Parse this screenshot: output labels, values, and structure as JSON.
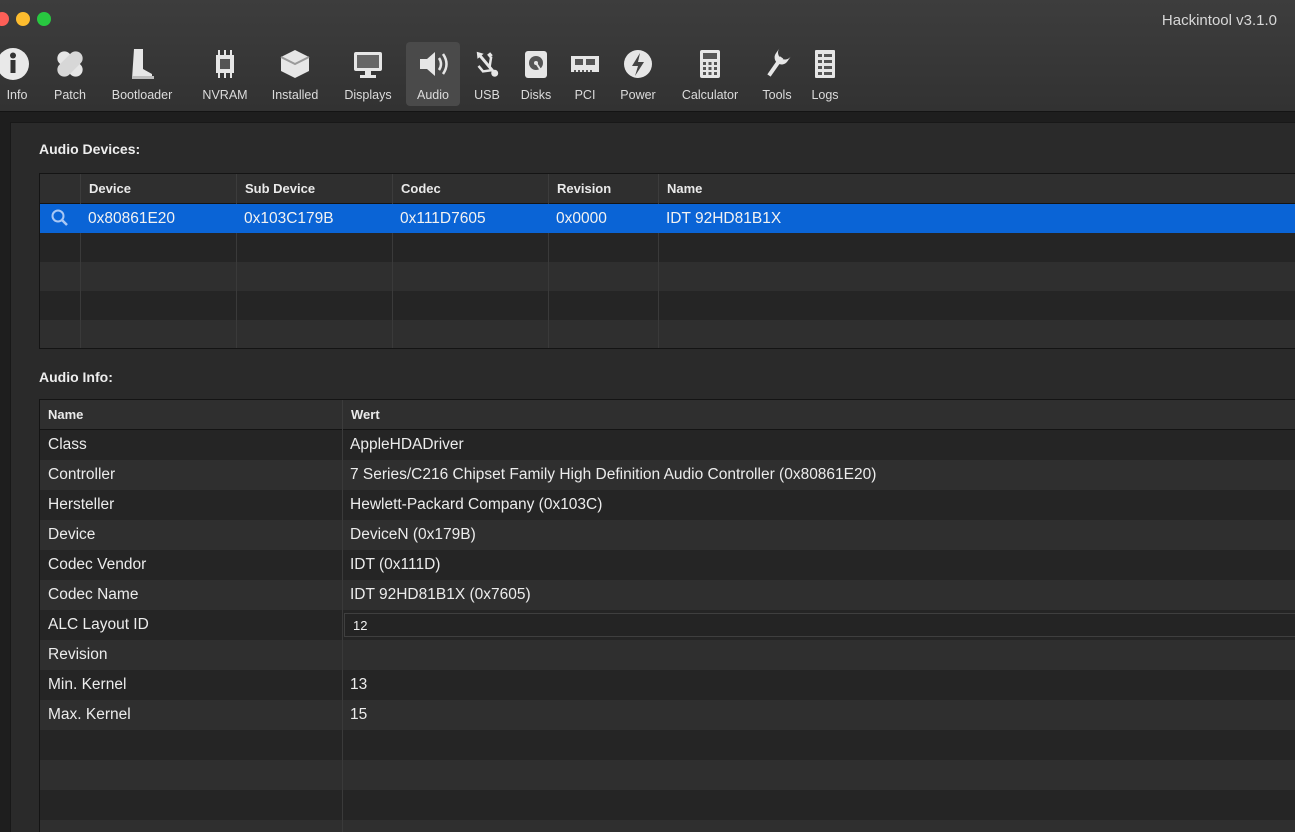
{
  "window": {
    "title": "Hackintool v3.1.0"
  },
  "toolbar": {
    "items": [
      {
        "label": "Info",
        "icon": "info-icon"
      },
      {
        "label": "Patch",
        "icon": "bandage-icon"
      },
      {
        "label": "Bootloader",
        "icon": "boot-icon"
      },
      {
        "label": "NVRAM",
        "icon": "chip-icon"
      },
      {
        "label": "Installed",
        "icon": "package-icon"
      },
      {
        "label": "Displays",
        "icon": "monitor-icon"
      },
      {
        "label": "Audio",
        "icon": "speaker-icon",
        "active": true
      },
      {
        "label": "USB",
        "icon": "usb-icon"
      },
      {
        "label": "Disks",
        "icon": "disk-icon"
      },
      {
        "label": "PCI",
        "icon": "pci-card-icon"
      },
      {
        "label": "Power",
        "icon": "power-icon"
      },
      {
        "label": "Calculator",
        "icon": "calculator-icon"
      },
      {
        "label": "Tools",
        "icon": "wrench-icon"
      },
      {
        "label": "Logs",
        "icon": "log-list-icon"
      }
    ]
  },
  "audio_devices": {
    "title": "Audio Devices:",
    "columns": [
      "Device",
      "Sub Device",
      "Codec",
      "Revision",
      "Name"
    ],
    "rows": [
      {
        "device": "0x80861E20",
        "sub_device": "0x103C179B",
        "codec": "0x111D7605",
        "revision": "0x0000",
        "name": "IDT 92HD81B1X",
        "selected": true
      }
    ]
  },
  "audio_info": {
    "title": "Audio Info:",
    "columns": [
      "Name",
      "Wert"
    ],
    "rows": [
      {
        "name": "Class",
        "value": "AppleHDADriver"
      },
      {
        "name": "Controller",
        "value": "7 Series/C216 Chipset Family High Definition Audio Controller (0x80861E20)"
      },
      {
        "name": "Hersteller",
        "value": "Hewlett-Packard Company (0x103C)"
      },
      {
        "name": "Device",
        "value": "DeviceN (0x179B)"
      },
      {
        "name": "Codec Vendor",
        "value": "IDT (0x111D)"
      },
      {
        "name": "Codec Name",
        "value": "IDT 92HD81B1X (0x7605)"
      },
      {
        "name": "ALC Layout ID",
        "value": "12",
        "editable": true
      },
      {
        "name": "Revision",
        "value": ""
      },
      {
        "name": "Min. Kernel",
        "value": "13"
      },
      {
        "name": "Max. Kernel",
        "value": "15"
      }
    ]
  },
  "colors": {
    "selection": "#0a64d6",
    "background": "#2a2a2a"
  }
}
